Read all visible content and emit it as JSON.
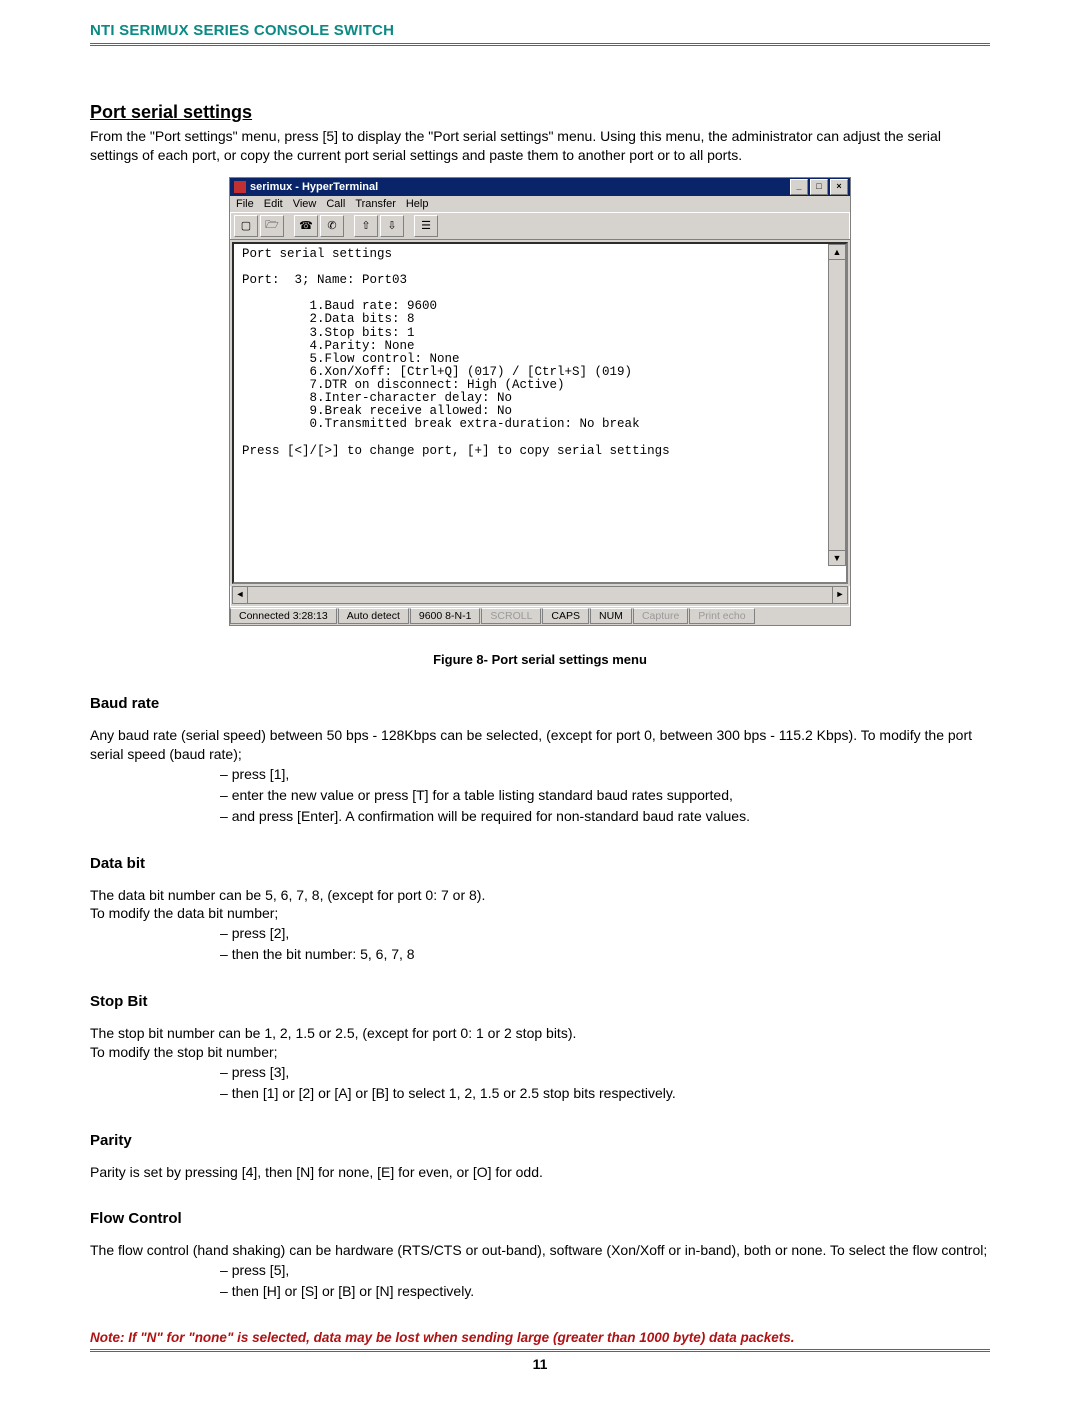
{
  "header": {
    "brand": "NTI SERIMUX SERIES CONSOLE SWITCH"
  },
  "section": {
    "title": "Port serial settings",
    "intro": "From the \"Port settings\" menu, press [5] to display the \"Port serial settings\" menu. Using this menu, the administrator can adjust the serial settings of each port, or copy the current port serial settings and paste them to another port or to all ports."
  },
  "figure": {
    "caption": "Figure 8- Port serial settings menu"
  },
  "baud": {
    "heading": "Baud rate",
    "text1": "Any baud rate (serial speed) between 50 bps - 128Kbps can be selected, (except for port 0,  between 300 bps - 115.2 Kbps). To modify the port serial speed (baud rate);",
    "items": [
      "press [1],",
      "enter the new value or press [T] for a table listing standard baud rates supported,",
      "and press [Enter].    A confirmation will be required for non-standard baud rate values."
    ]
  },
  "databit": {
    "heading": "Data bit",
    "text1": "The data bit number can be 5, 6, 7, 8, (except for port 0:  7 or 8).",
    "text2": "To modify the data bit number;",
    "items": [
      "press [2],",
      "then the bit number: 5, 6, 7, 8"
    ]
  },
  "stopbit": {
    "heading": "Stop Bit",
    "text1": " The stop bit number can be 1, 2, 1.5 or 2.5, (except for port 0: 1 or 2 stop bits).",
    "text2": " To modify the stop bit number;",
    "items": [
      "press [3],",
      "then [1] or [2] or [A] or [B] to select 1, 2, 1.5 or 2.5 stop bits respectively."
    ]
  },
  "parity": {
    "heading": "Parity",
    "text1": "Parity is set by pressing [4], then  [N] for none,  [E] for even,  or  [O] for odd."
  },
  "flow": {
    "heading": "Flow Control",
    "text1": "The flow control (hand shaking) can be hardware (RTS/CTS or out-band), software (Xon/Xoff or in-band), both or none. To select the flow control;",
    "items": [
      "press [5],",
      "then [H] or [S] or [B] or [N] respectively."
    ],
    "note": "Note: If  \"N\" for \"none\" is selected, data may be lost when sending large (greater than 1000 byte) data packets."
  },
  "page_number": "11",
  "hyperterminal": {
    "title": "serimux - HyperTerminal",
    "menus": [
      "File",
      "Edit",
      "View",
      "Call",
      "Transfer",
      "Help"
    ],
    "toolbar_icons": [
      "new-doc-icon",
      "open-icon",
      "connect-icon",
      "disconnect-icon",
      "send-icon",
      "receive-icon",
      "properties-icon"
    ],
    "terminal_lines": [
      "Port serial settings",
      "",
      "Port:  3; Name: Port03",
      "",
      "         1.Baud rate: 9600",
      "         2.Data bits: 8",
      "         3.Stop bits: 1",
      "         4.Parity: None",
      "         5.Flow control: None",
      "         6.Xon/Xoff: [Ctrl+Q] (017) / [Ctrl+S] (019)",
      "         7.DTR on disconnect: High (Active)",
      "         8.Inter-character delay: No",
      "         9.Break receive allowed: No",
      "         0.Transmitted break extra-duration: No break",
      "",
      "Press [<]/[>] to change port, [+] to copy serial settings"
    ],
    "status": {
      "connected": "Connected 3:28:13",
      "autodetect": "Auto detect",
      "settings": "9600 8-N-1",
      "scroll": "SCROLL",
      "caps": "CAPS",
      "num": "NUM",
      "capture": "Capture",
      "printecho": "Print echo"
    }
  }
}
